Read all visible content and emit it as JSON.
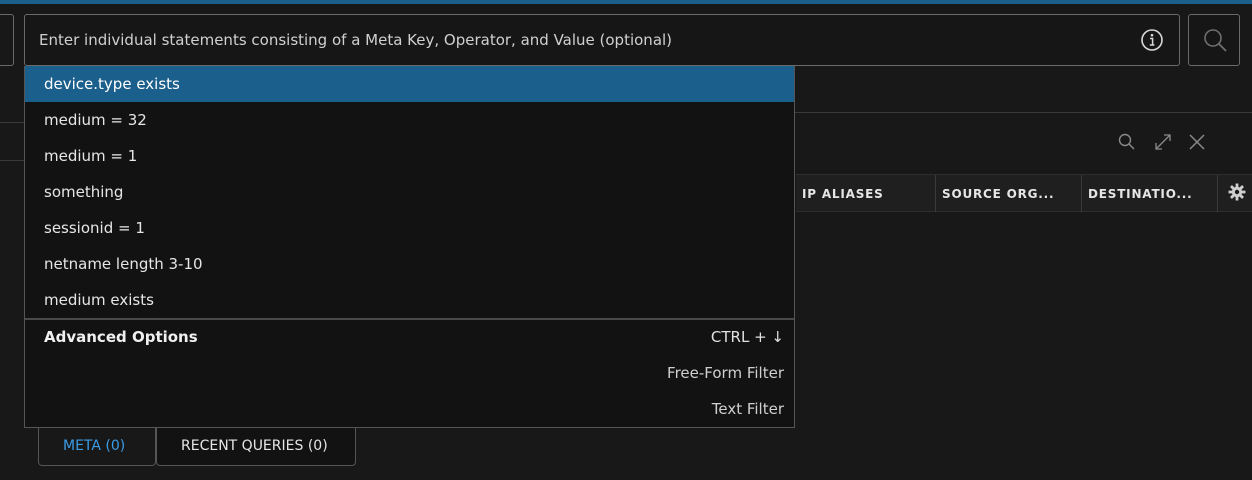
{
  "query": {
    "placeholder": "Enter individual statements consisting of a Meta Key, Operator, and Value (optional)",
    "value": ""
  },
  "suggestions": [
    {
      "label": "device.type exists",
      "highlighted": true
    },
    {
      "label": "medium = 32",
      "highlighted": false
    },
    {
      "label": "medium = 1",
      "highlighted": false
    },
    {
      "label": "something",
      "highlighted": false
    },
    {
      "label": "sessionid = 1",
      "highlighted": false
    },
    {
      "label": "netname length 3-10",
      "highlighted": false
    },
    {
      "label": "medium exists",
      "highlighted": false
    }
  ],
  "advanced": {
    "title": "Advanced Options",
    "shortcut": "CTRL + ↓",
    "options": [
      "Free-Form Filter",
      "Text Filter"
    ]
  },
  "tabs": [
    {
      "label": "META (0)",
      "active": true
    },
    {
      "label": "RECENT QUERIES (0)",
      "active": false
    }
  ],
  "columns": [
    "IP ALIASES",
    "SOURCE ORG...",
    "DESTINATIO..."
  ],
  "colors": {
    "accent": "#1b5f8c",
    "active_tab": "#3b9ce8",
    "background": "#181818"
  }
}
